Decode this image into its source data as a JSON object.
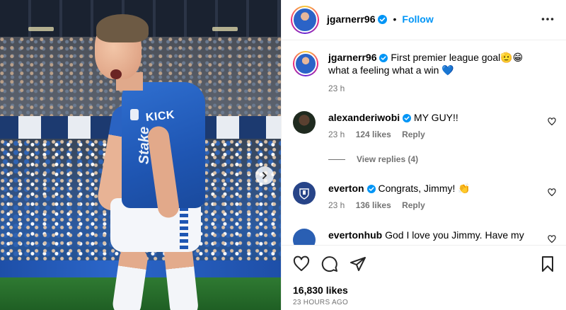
{
  "header": {
    "username": "jgarnerr96",
    "dot": "•",
    "follow_label": "Follow"
  },
  "photo": {
    "shirt_text": "KICK",
    "sponsor_text": "Stake"
  },
  "caption": {
    "username": "jgarnerr96",
    "text": "First premier league goal🫡😁 what a feeling what a win 💙",
    "time": "23 h"
  },
  "comments": [
    {
      "username": "alexanderiwobi",
      "text": "MY GUY!!",
      "time": "23 h",
      "likes": "124 likes",
      "reply": "Reply"
    },
    {
      "username": "everton",
      "text": "Congrats, Jimmy! 👏",
      "time": "23 h",
      "likes": "136 likes",
      "reply": "Reply"
    },
    {
      "username": "evertonhub",
      "text": "God I love you Jimmy. Have my"
    }
  ],
  "view_replies": "View replies (4)",
  "likes_count": "16,830 likes",
  "time_ago": "23 HOURS AGO",
  "colors": {
    "accent": "#0095f6",
    "everton_blue": "#274488"
  }
}
